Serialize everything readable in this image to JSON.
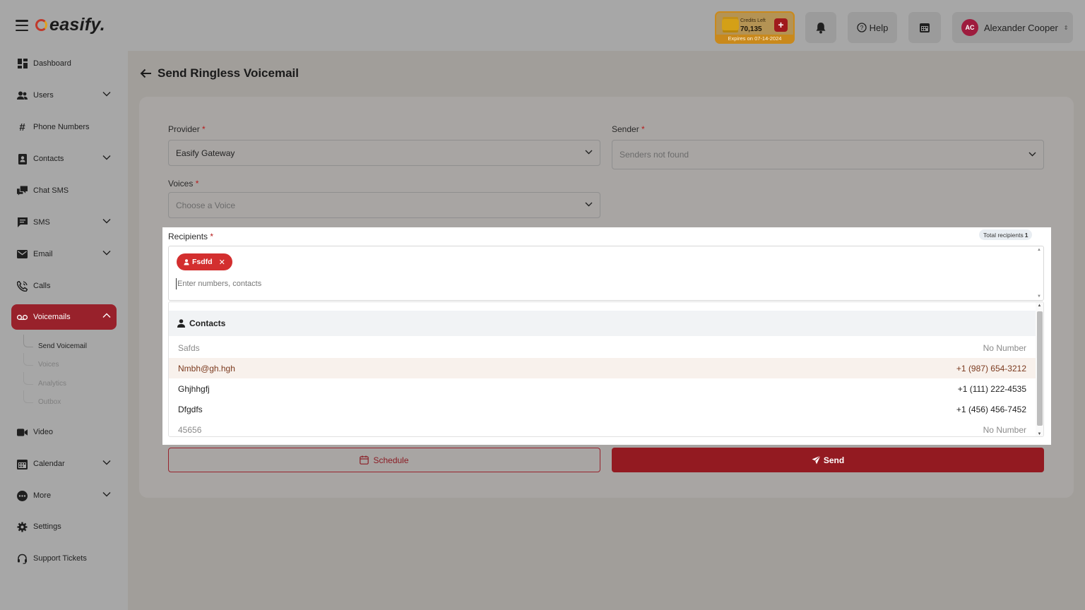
{
  "app": {
    "logo_text": "easify."
  },
  "topbar": {
    "credits_label": "Credits Left",
    "credits_value": "70,135",
    "credits_expiry": "Expires on 07-14-2024",
    "help_label": "Help",
    "user_initials": "AC",
    "user_name": "Alexander Cooper"
  },
  "sidebar": {
    "items": [
      {
        "label": "Dashboard",
        "icon": "dashboard-icon"
      },
      {
        "label": "Users",
        "icon": "users-icon",
        "expandable": true
      },
      {
        "label": "Phone Numbers",
        "icon": "hash-icon"
      },
      {
        "label": "Contacts",
        "icon": "contacts-icon",
        "expandable": true
      },
      {
        "label": "Chat SMS",
        "icon": "chat-icon"
      },
      {
        "label": "SMS",
        "icon": "sms-icon",
        "expandable": true
      },
      {
        "label": "Email",
        "icon": "mail-icon",
        "expandable": true
      },
      {
        "label": "Calls",
        "icon": "phone-icon"
      },
      {
        "label": "Voicemails",
        "icon": "voicemail-icon",
        "expandable": true,
        "active": true
      },
      {
        "label": "Video",
        "icon": "video-icon"
      },
      {
        "label": "Calendar",
        "icon": "calendar-icon",
        "expandable": true
      },
      {
        "label": "More",
        "icon": "more-icon",
        "expandable": true
      },
      {
        "label": "Settings",
        "icon": "gear-icon"
      },
      {
        "label": "Support Tickets",
        "icon": "headset-icon"
      }
    ],
    "voicemail_sub": [
      "Send Voicemail",
      "Voices",
      "Analytics",
      "Outbox"
    ]
  },
  "page": {
    "title": "Send Ringless Voicemail",
    "provider_label": "Provider",
    "provider_value": "Easify Gateway",
    "sender_label": "Sender",
    "sender_value": "Senders not found",
    "voices_label": "Voices",
    "voices_value": "Choose a Voice",
    "required_mark": "*",
    "recipients_label": "Recipients",
    "total_recipients_label": "Total recipients",
    "total_recipients_count": "1",
    "chip_label": "Fsdfd",
    "recipients_placeholder": "Enter numbers, contacts",
    "contacts_header": "Contacts",
    "contacts": [
      {
        "name": "Safds",
        "number": "No Number",
        "state": "muted"
      },
      {
        "name": "Nmbh@gh.hgh",
        "number": "+1 (987) 654-3212",
        "state": "highlighted"
      },
      {
        "name": "Ghjhhgfj",
        "number": "+1 (111) 222-4535",
        "state": "normal"
      },
      {
        "name": "Dfgdfs",
        "number": "+1 (456) 456-7452",
        "state": "normal"
      },
      {
        "name": "45656",
        "number": "No Number",
        "state": "muted"
      }
    ],
    "schedule_label": "Schedule",
    "send_label": "Send"
  }
}
